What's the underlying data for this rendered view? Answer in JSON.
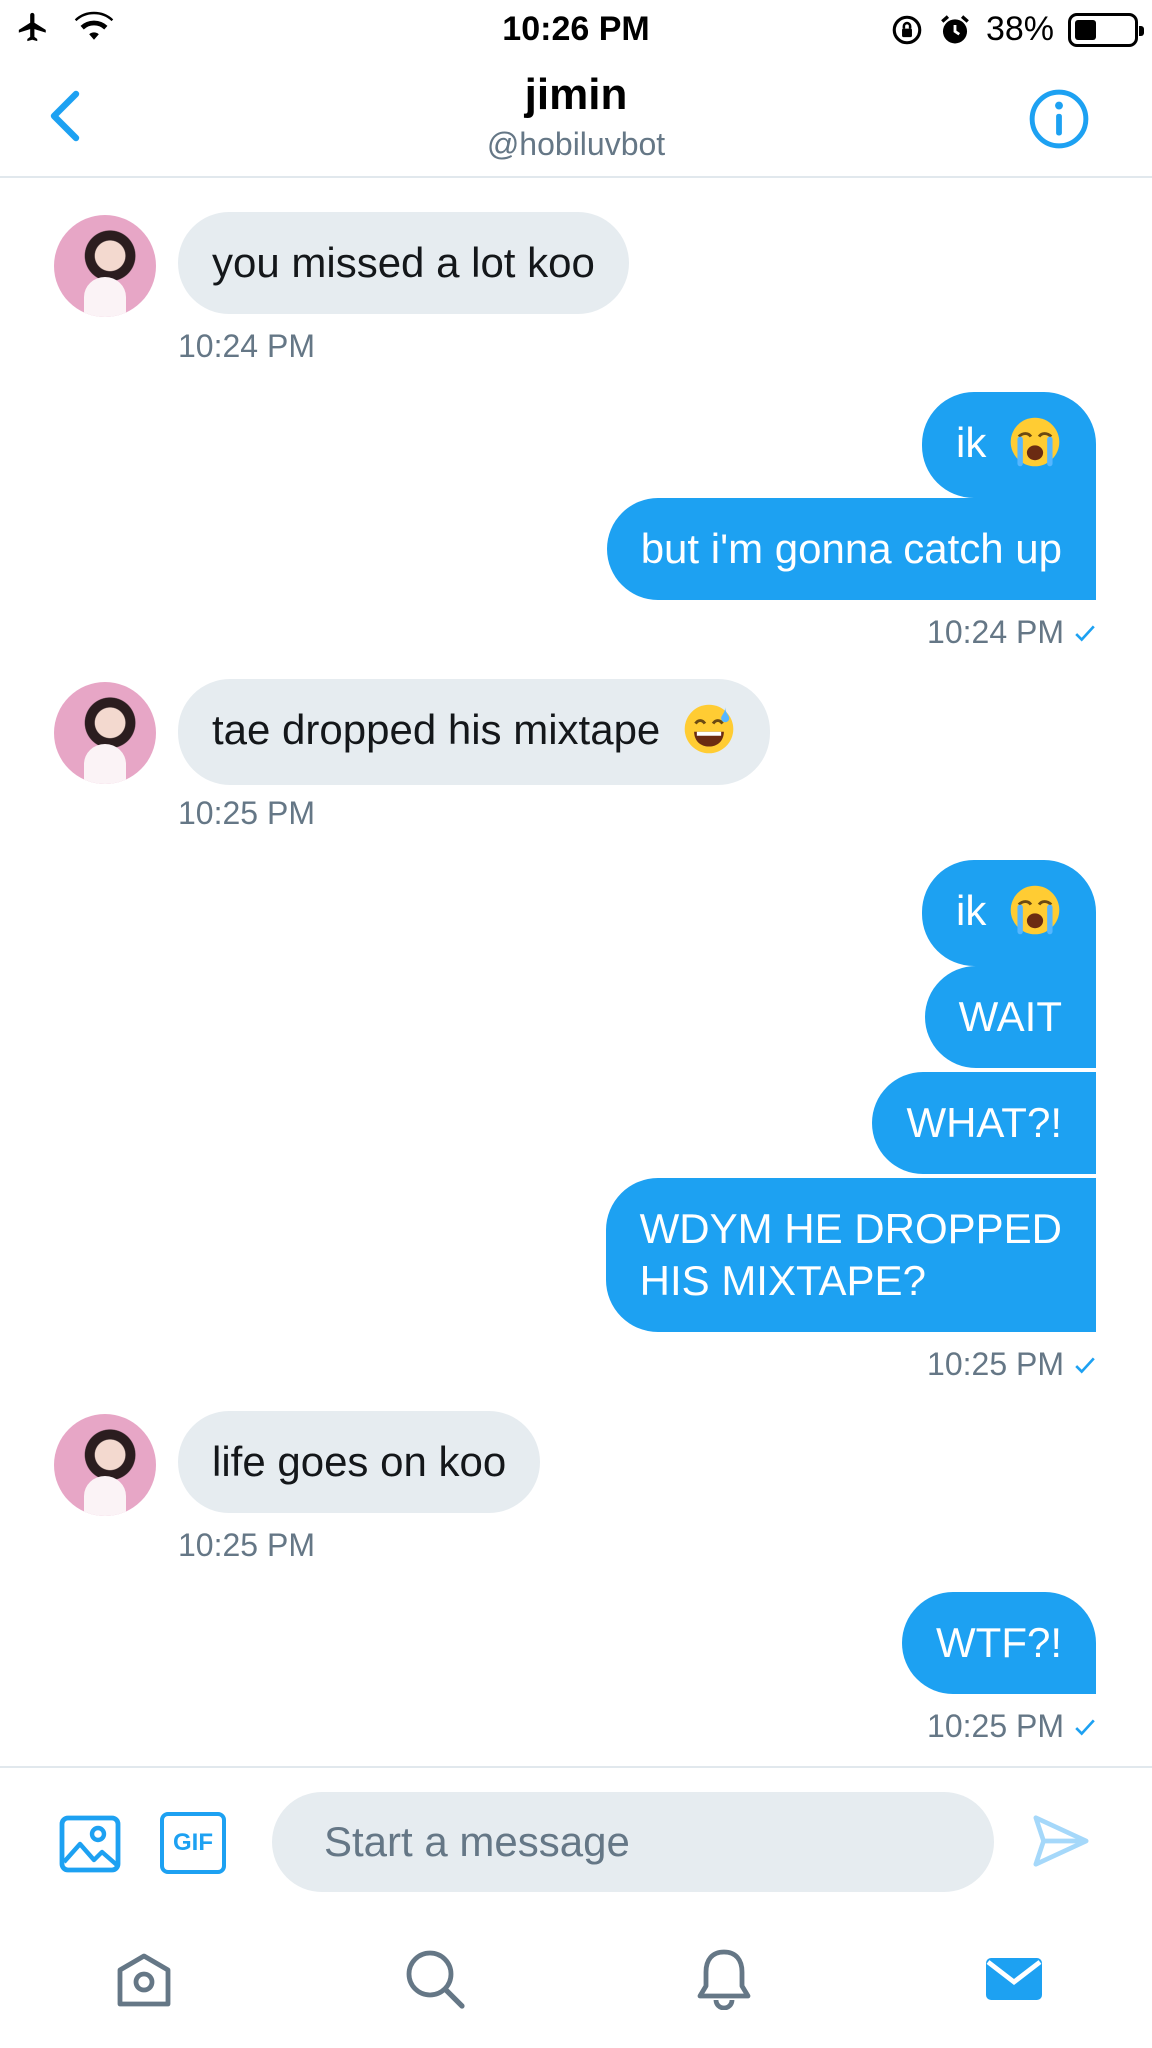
{
  "status_bar": {
    "time": "10:26 PM",
    "battery_text": "38%",
    "battery_level": 0.38,
    "icons": [
      "airplane-icon",
      "wifi-icon",
      "rotation-lock-icon",
      "alarm-icon",
      "battery-icon"
    ]
  },
  "header": {
    "name": "jimin",
    "handle": "@hobiluvbot"
  },
  "messages": [
    {
      "direction": "in",
      "text": "you missed a lot koo",
      "time": "10:24 PM"
    },
    {
      "direction": "out",
      "text": "ik",
      "emoji": "loudly-crying-face"
    },
    {
      "direction": "out",
      "text": "but i'm gonna catch up",
      "time": "10:24 PM",
      "read": true
    },
    {
      "direction": "in",
      "text": "tae dropped his mixtape",
      "emoji": "grinning-face-with-sweat",
      "time": "10:25 PM"
    },
    {
      "direction": "out",
      "text": "ik",
      "emoji": "loudly-crying-face"
    },
    {
      "direction": "out",
      "text": "WAIT"
    },
    {
      "direction": "out",
      "text": "WHAT?!"
    },
    {
      "direction": "out",
      "text_line1": "WDYM HE DROPPED",
      "text_line2": "HIS MIXTAPE?",
      "time": "10:25 PM",
      "read": true
    },
    {
      "direction": "in",
      "text": "life goes on koo",
      "time": "10:25 PM"
    },
    {
      "direction": "out",
      "text": "WTF?!",
      "time": "10:25 PM",
      "read": true
    }
  ],
  "composer": {
    "gif_label": "GIF",
    "placeholder": "Start a message"
  },
  "tabs": [
    "home-icon",
    "search-icon",
    "notifications-icon",
    "messages-icon"
  ],
  "colors": {
    "accent": "#1da1f2",
    "incoming_bubble": "#e6ecf0",
    "secondary_text": "#657786"
  }
}
